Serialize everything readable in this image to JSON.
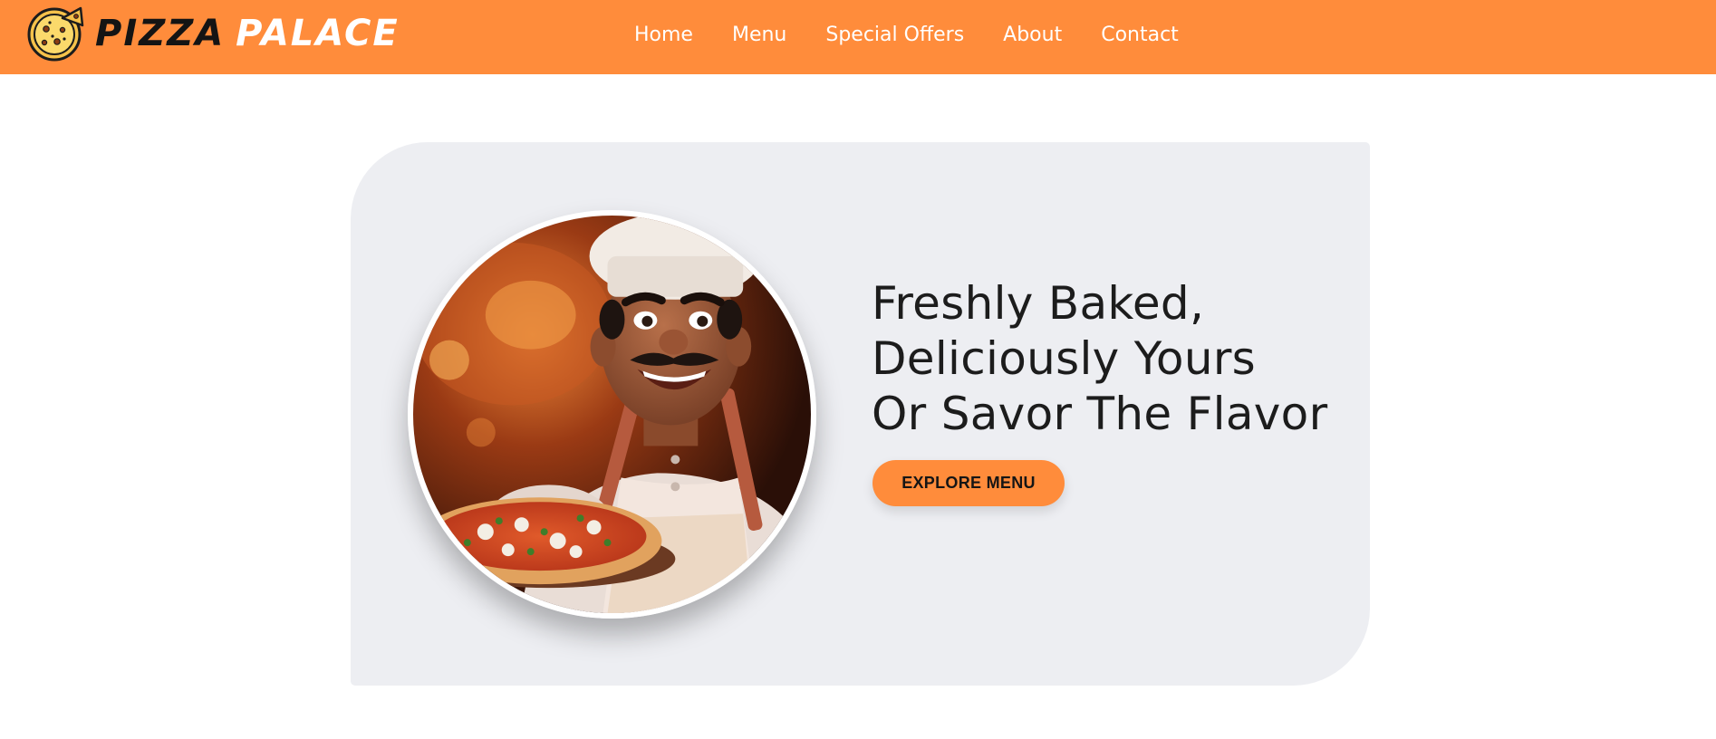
{
  "brand": {
    "word_1": "PIZZA",
    "word_2": "PALACE",
    "logo_icon": "pizza-icon",
    "accent_color": "#ff8c3b"
  },
  "nav": {
    "items": [
      "Home",
      "Menu",
      "Special Offers",
      "About",
      "Contact"
    ]
  },
  "hero": {
    "headline_lines": [
      "Freshly Baked,",
      "Deliciously Yours",
      "Or Savor The Flavor"
    ],
    "cta_label": "EXPLORE MENU",
    "image_subject": "chef-holding-pizza",
    "panel_color": "#edeef2"
  }
}
